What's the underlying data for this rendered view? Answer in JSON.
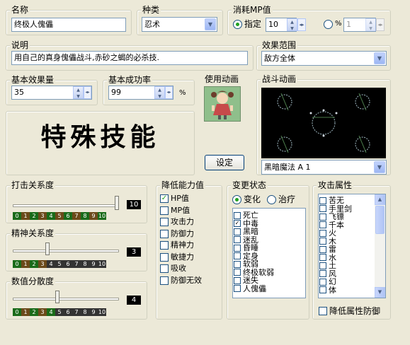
{
  "name": {
    "label": "名称",
    "value": "终极人傀儡"
  },
  "type": {
    "label": "种类",
    "value": "忍术"
  },
  "mp": {
    "label": "消耗MP值",
    "fixed_label": "指定",
    "fixed_value": "10",
    "percent_label": "%",
    "percent_value": "1"
  },
  "desc": {
    "label": "说明",
    "value": "用自己的真身傀儡战斗,赤砂之蝎的必杀技."
  },
  "range": {
    "label": "效果范围",
    "value": "敌方全体"
  },
  "base_effect": {
    "label": "基本效果量",
    "value": "35"
  },
  "base_rate": {
    "label": "基本成功率",
    "value": "99",
    "unit": "%"
  },
  "banner": {
    "text": "特殊技能"
  },
  "use_anim": {
    "label": "使用动画",
    "set_button": "设定"
  },
  "battle_anim": {
    "label": "战斗动画",
    "value": "黑暗魔法 A 1"
  },
  "hit": {
    "label": "打击关系度",
    "value": "10",
    "level": 10
  },
  "spirit": {
    "label": "精神关系度",
    "value": "3",
    "level": 3
  },
  "variance": {
    "label": "数值分散度",
    "value": "4",
    "level": 4
  },
  "scale_ticks": [
    "0",
    "1",
    "2",
    "3",
    "4",
    "5",
    "6",
    "7",
    "8",
    "9",
    "10"
  ],
  "reduce": {
    "label": "降低能力值",
    "items": [
      {
        "label": "HP值",
        "checked": true
      },
      {
        "label": "MP值",
        "checked": false
      },
      {
        "label": "攻击力",
        "checked": false
      },
      {
        "label": "防御力",
        "checked": false
      },
      {
        "label": "精神力",
        "checked": false
      },
      {
        "label": "敏捷力",
        "checked": false
      },
      {
        "label": "吸收",
        "checked": false
      },
      {
        "label": "防御无效",
        "checked": false
      }
    ]
  },
  "state": {
    "label": "变更状态",
    "change_label": "变化",
    "cure_label": "治疗",
    "items": [
      "死亡",
      "中毒",
      "黑暗",
      "迷乱",
      "昏睡",
      "定身",
      "软弱",
      "终极软弱",
      "迷失",
      "人傀儡"
    ],
    "checked_index": 1
  },
  "attr": {
    "label": "攻击属性",
    "items": [
      "苦无",
      "手里剑",
      "飞镖",
      "千本",
      "火",
      "木",
      "雷",
      "水",
      "土",
      "风",
      "幻",
      "体"
    ],
    "reduce_def_label": "降低属性防御"
  }
}
